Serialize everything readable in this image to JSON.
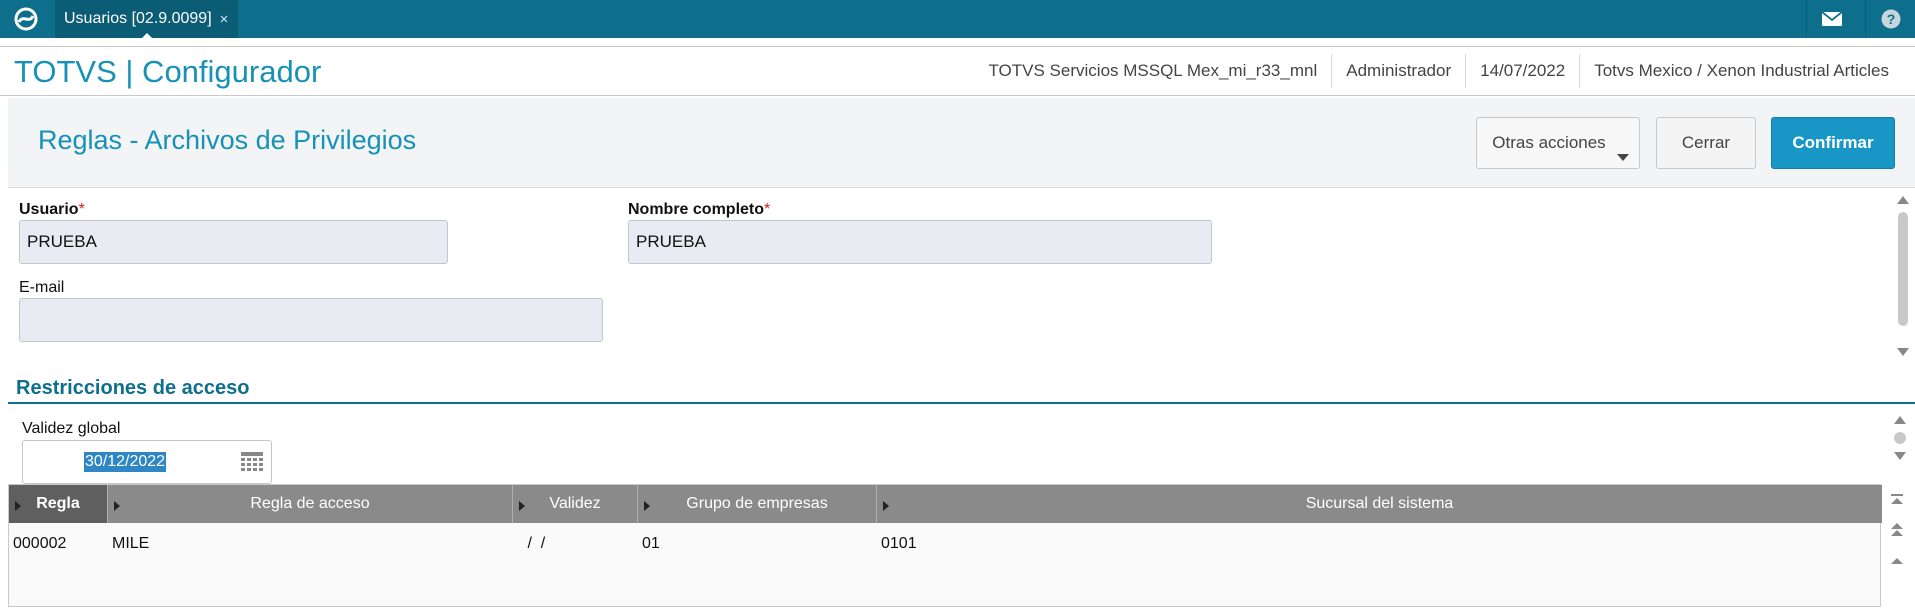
{
  "topbar": {
    "tab_label": "Usuarios [02.9.0099]",
    "tab_close": "×",
    "accent": "#0e6f8c"
  },
  "header": {
    "app_title": "TOTVS | Configurador",
    "environment": "TOTVS Servicios MSSQL Mex_mi_r33_mnl",
    "user": "Administrador",
    "date": "14/07/2022",
    "company": "Totvs Mexico / Xenon Industrial Articles"
  },
  "subheader": {
    "page_title": "Reglas - Archivos de Privilegios",
    "more_actions": "Otras acciones",
    "close": "Cerrar",
    "confirm": "Confirmar"
  },
  "form": {
    "usuario_label": "Usuario",
    "usuario_value": "PRUEBA",
    "nombre_label": "Nombre completo",
    "nombre_value": "PRUEBA",
    "email_label": "E-mail",
    "email_value": "",
    "required_mark": "*"
  },
  "section": {
    "title": "Restricciones de acceso",
    "validez_label": "Validez global",
    "validez_value": "30/12/2022"
  },
  "grid": {
    "columns": [
      "Regla",
      "Regla de acceso",
      "Validez",
      "Grupo de empresas",
      "Sucursal del sistema"
    ],
    "rows": [
      [
        "000002",
        "MILE",
        " /  /",
        "01",
        "0101"
      ]
    ]
  }
}
